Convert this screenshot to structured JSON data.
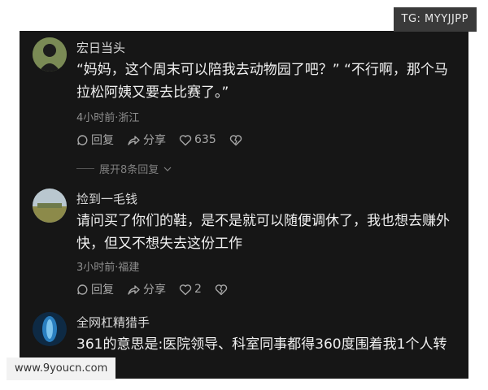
{
  "watermarks": {
    "top": "TG: MYYJJPP",
    "bottom": "www.9youcn.com"
  },
  "comments": [
    {
      "username": "宏日当头",
      "text": "“妈妈，这个周末可以陪我去动物园了吧？” “不行啊，那个马拉松阿姨又要去比赛了。”",
      "meta": "4小时前·浙江",
      "reply_label": "回复",
      "share_label": "分享",
      "like_count": "635",
      "expand_label": "展开8条回复"
    },
    {
      "username": "捡到一毛钱",
      "text": "请问买了你们的鞋，是不是就可以随便调休了，我也想去赚外快，但又不想失去这份工作",
      "meta": "3小时前·福建",
      "reply_label": "回复",
      "share_label": "分享",
      "like_count": "2"
    },
    {
      "username": "全网杠精猎手",
      "text": "361的意思是:医院领导、科室同事都得360度围着我1个人转"
    }
  ],
  "colors": {
    "background": "#161616",
    "text": "#f0f0f0",
    "muted": "#8f8f8f"
  }
}
